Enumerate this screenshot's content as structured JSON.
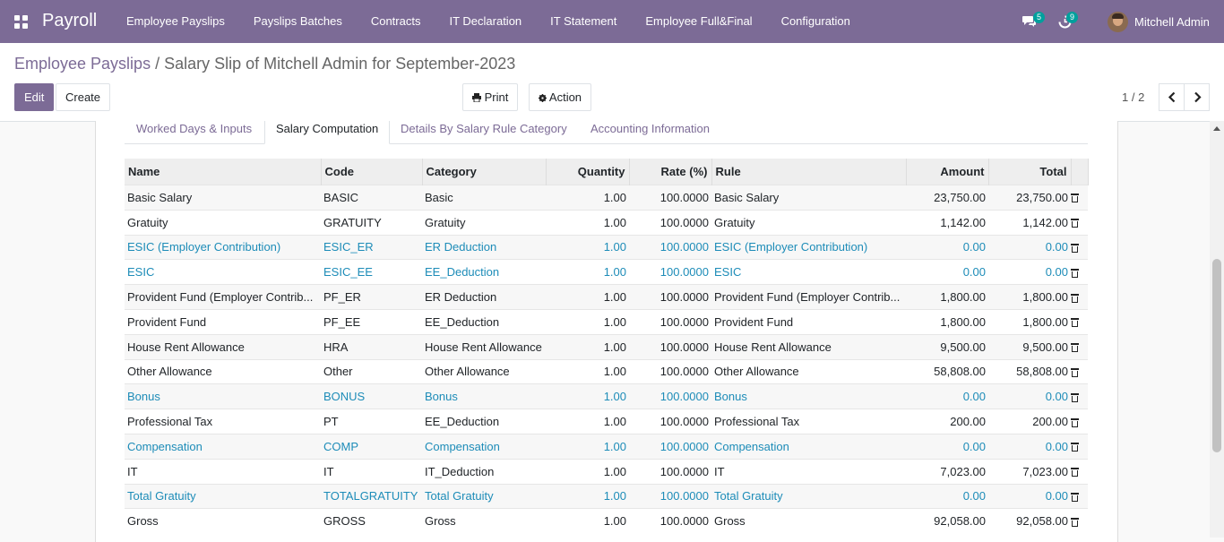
{
  "navbar": {
    "app_name": "Payroll",
    "menu": [
      "Employee Payslips",
      "Payslips Batches",
      "Contracts",
      "IT Declaration",
      "IT Statement",
      "Employee Full&Final",
      "Configuration"
    ],
    "messages_count": "5",
    "activities_count": "9",
    "user_name": "Mitchell Admin",
    "accent_color": "#7c6b96"
  },
  "breadcrumb": {
    "parent": "Employee Payslips",
    "separator": "/",
    "current": "Salary Slip of Mitchell Admin for September-2023"
  },
  "toolbar": {
    "edit_label": "Edit",
    "create_label": "Create",
    "print_label": "Print",
    "action_label": "Action"
  },
  "pager": {
    "value": "1 / 2"
  },
  "tabs": [
    "Worked Days & Inputs",
    "Salary Computation",
    "Details By Salary Rule Category",
    "Accounting Information"
  ],
  "active_tab": "Salary Computation",
  "table": {
    "columns": [
      "Name",
      "Code",
      "Category",
      "Quantity",
      "Rate (%)",
      "Rule",
      "Amount",
      "Total"
    ],
    "rows": [
      {
        "name": "Basic Salary",
        "code": "BASIC",
        "category": "Basic",
        "quantity": "1.00",
        "rate": "100.0000",
        "rule": "Basic Salary",
        "amount": "23,750.00",
        "total": "23,750.00",
        "zero": false
      },
      {
        "name": "Gratuity",
        "code": "GRATUITY",
        "category": "Gratuity",
        "quantity": "1.00",
        "rate": "100.0000",
        "rule": "Gratuity",
        "amount": "1,142.00",
        "total": "1,142.00",
        "zero": false
      },
      {
        "name": "ESIC (Employer Contribution)",
        "code": "ESIC_ER",
        "category": "ER Deduction",
        "quantity": "1.00",
        "rate": "100.0000",
        "rule": "ESIC (Employer Contribution)",
        "amount": "0.00",
        "total": "0.00",
        "zero": true
      },
      {
        "name": "ESIC",
        "code": "ESIC_EE",
        "category": "EE_Deduction",
        "quantity": "1.00",
        "rate": "100.0000",
        "rule": "ESIC",
        "amount": "0.00",
        "total": "0.00",
        "zero": true
      },
      {
        "name": "Provident Fund (Employer Contrib...",
        "code": "PF_ER",
        "category": "ER Deduction",
        "quantity": "1.00",
        "rate": "100.0000",
        "rule": "Provident Fund (Employer Contrib...",
        "amount": "1,800.00",
        "total": "1,800.00",
        "zero": false
      },
      {
        "name": "Provident Fund",
        "code": "PF_EE",
        "category": "EE_Deduction",
        "quantity": "1.00",
        "rate": "100.0000",
        "rule": "Provident Fund",
        "amount": "1,800.00",
        "total": "1,800.00",
        "zero": false
      },
      {
        "name": "House Rent Allowance",
        "code": "HRA",
        "category": "House Rent Allowance",
        "quantity": "1.00",
        "rate": "100.0000",
        "rule": "House Rent Allowance",
        "amount": "9,500.00",
        "total": "9,500.00",
        "zero": false
      },
      {
        "name": "Other Allowance",
        "code": "Other",
        "category": "Other Allowance",
        "quantity": "1.00",
        "rate": "100.0000",
        "rule": "Other Allowance",
        "amount": "58,808.00",
        "total": "58,808.00",
        "zero": false
      },
      {
        "name": "Bonus",
        "code": "BONUS",
        "category": "Bonus",
        "quantity": "1.00",
        "rate": "100.0000",
        "rule": "Bonus",
        "amount": "0.00",
        "total": "0.00",
        "zero": true
      },
      {
        "name": "Professional Tax",
        "code": "PT",
        "category": "EE_Deduction",
        "quantity": "1.00",
        "rate": "100.0000",
        "rule": "Professional Tax",
        "amount": "200.00",
        "total": "200.00",
        "zero": false
      },
      {
        "name": "Compensation",
        "code": "COMP",
        "category": "Compensation",
        "quantity": "1.00",
        "rate": "100.0000",
        "rule": "Compensation",
        "amount": "0.00",
        "total": "0.00",
        "zero": true
      },
      {
        "name": "IT",
        "code": "IT",
        "category": "IT_Deduction",
        "quantity": "1.00",
        "rate": "100.0000",
        "rule": "IT",
        "amount": "7,023.00",
        "total": "7,023.00",
        "zero": false
      },
      {
        "name": "Total Gratuity",
        "code": "TOTALGRATUITY",
        "category": "Total Gratuity",
        "quantity": "1.00",
        "rate": "100.0000",
        "rule": "Total Gratuity",
        "amount": "0.00",
        "total": "0.00",
        "zero": true
      },
      {
        "name": "Gross",
        "code": "GROSS",
        "category": "Gross",
        "quantity": "1.00",
        "rate": "100.0000",
        "rule": "Gross",
        "amount": "92,058.00",
        "total": "92,058.00",
        "zero": false
      }
    ]
  },
  "colors": {
    "zero_row_text": "#1d8cb8",
    "tab_link": "#7c6b96",
    "badge": "#00a09d"
  }
}
